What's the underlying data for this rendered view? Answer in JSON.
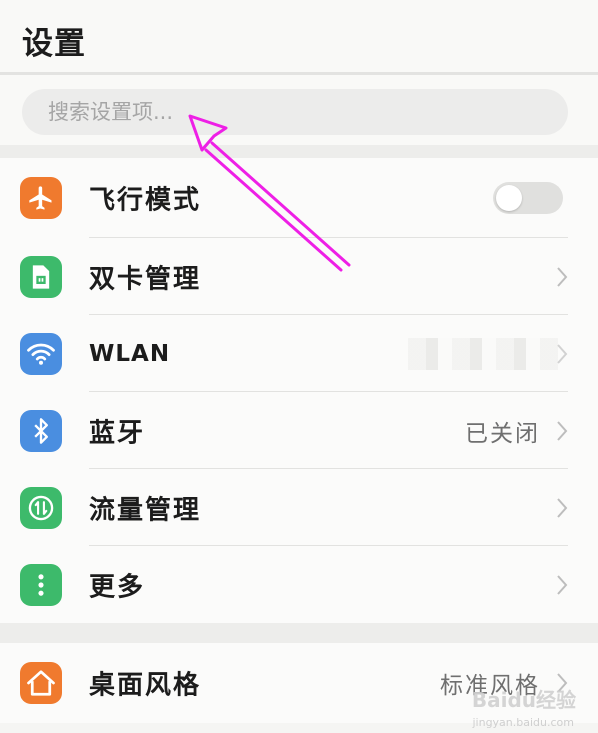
{
  "header": {
    "title": "设置"
  },
  "search": {
    "placeholder": "搜索设置项..."
  },
  "groups": [
    {
      "items": [
        {
          "label": "飞行模式",
          "icon": "airplane-icon",
          "icon_color": "#f07a2e",
          "control": "toggle",
          "toggle_on": false
        },
        {
          "label": "双卡管理",
          "icon": "sim-card-icon",
          "icon_color": "#3dba6b",
          "control": "chevron"
        },
        {
          "label": "WLAN",
          "icon": "wifi-icon",
          "icon_color": "#4a8ee0",
          "control": "chevron"
        },
        {
          "label": "蓝牙",
          "icon": "bluetooth-icon",
          "icon_color": "#4a8ee0",
          "control": "chevron",
          "value": "已关闭"
        },
        {
          "label": "流量管理",
          "icon": "data-usage-icon",
          "icon_color": "#3dba6b",
          "control": "chevron"
        },
        {
          "label": "更多",
          "icon": "more-icon",
          "icon_color": "#3dba6b",
          "control": "chevron"
        }
      ]
    },
    {
      "items": [
        {
          "label": "桌面风格",
          "icon": "home-style-icon",
          "icon_color": "#f07a2e",
          "control": "chevron",
          "value": "标准风格"
        }
      ]
    }
  ],
  "watermark": {
    "text": "Baidu经验",
    "sub": "jingyan.baidu.com"
  },
  "colors": {
    "annotation_arrow": "#ee1fe6",
    "toggle_off": "#e0e0de"
  }
}
